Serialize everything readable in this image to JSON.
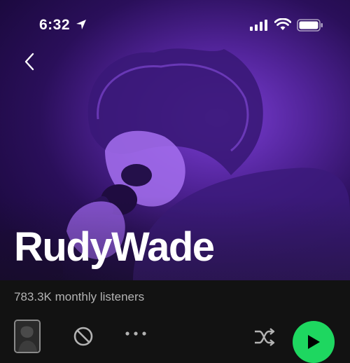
{
  "status_bar": {
    "time": "6:32",
    "icons": [
      "location-arrow-icon",
      "signal-icon",
      "wifi-icon",
      "battery-icon"
    ]
  },
  "header": {
    "back_icon": "chevron-left-icon"
  },
  "artist": {
    "name": "RudyWade",
    "monthly_listeners": "783.3K monthly listeners"
  },
  "controls": {
    "icons": [
      "block-icon",
      "more-icon",
      "shuffle-icon",
      "play-icon"
    ]
  },
  "colors": {
    "background": "#121212",
    "hero_tint": "#6a2fc4",
    "accent": "#1ed760",
    "secondary_text": "#b3b3b3"
  }
}
